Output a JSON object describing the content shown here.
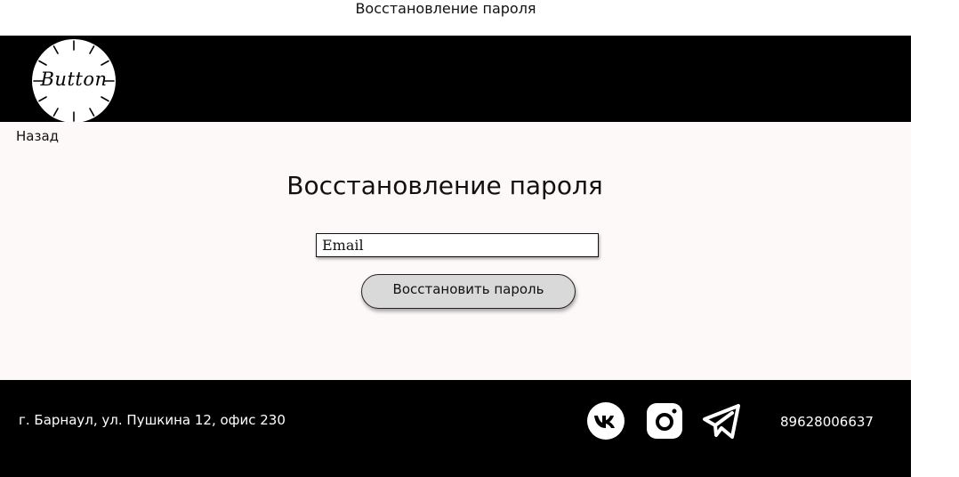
{
  "page": {
    "caption": "Восстановление пароля"
  },
  "header": {
    "logo_text": "Button",
    "logo_icon": "button-clock-logo"
  },
  "content": {
    "back_label": "Назад",
    "title": "Восстановление пароля",
    "email_placeholder": "Email",
    "email_value": "",
    "submit_label": "Восстановить пароль"
  },
  "footer": {
    "address": "г. Барнаул, ул. Пушкина 12, офис 230",
    "phone": "89628006637",
    "social_icons": [
      "vk-icon",
      "instagram-icon",
      "telegram-icon"
    ]
  },
  "colors": {
    "header_bg": "#000000",
    "content_bg": "#fdf9f8",
    "footer_bg": "#000000",
    "button_bg": "#d9d9d9"
  }
}
